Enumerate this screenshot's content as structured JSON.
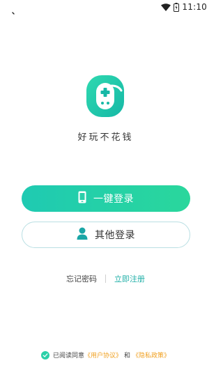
{
  "status_bar": {
    "time": "11:10"
  },
  "app": {
    "tagline": "好玩不花钱"
  },
  "buttons": {
    "one_click_login": "一键登录",
    "other_login": "其他登录"
  },
  "links": {
    "forgot_password": "忘记密码",
    "register_now": "立即注册"
  },
  "agreement": {
    "prefix": "已阅读同意",
    "user_agreement": "《用户协议》",
    "and": "和",
    "privacy_policy": "《隐私政策》"
  },
  "colors": {
    "brand_gradient_start": "#1fcab2",
    "brand_gradient_end": "#2ad79c",
    "link_teal": "#22b0a8",
    "link_orange": "#f0a020"
  },
  "icons": {
    "wifi": "wifi-icon",
    "battery": "battery-icon",
    "back": "back-icon",
    "logo": "gamepad-logo-icon",
    "phone": "phone-icon",
    "person": "person-icon",
    "check": "check-icon"
  }
}
